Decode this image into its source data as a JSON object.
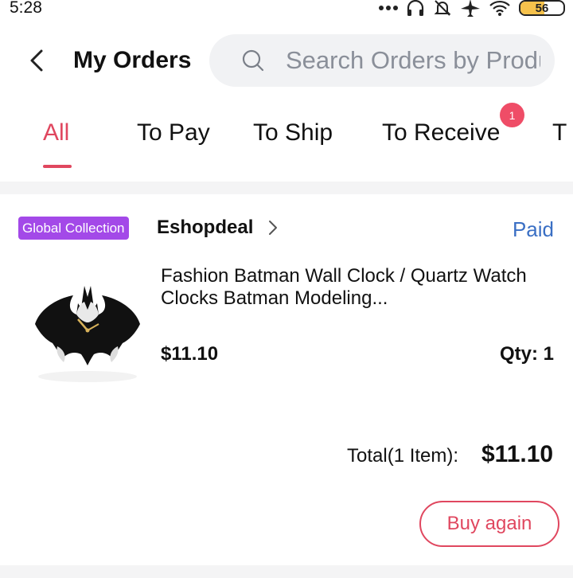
{
  "status_bar": {
    "time": "5:28",
    "battery": "56",
    "battery_level": 0.56,
    "icons": [
      "more-dots-icon",
      "headset-icon",
      "bell-off-icon",
      "airplane-icon",
      "wifi-icon",
      "battery-icon"
    ]
  },
  "header": {
    "title": "My Orders",
    "search_placeholder": "Search Orders by Product Name"
  },
  "tabs": [
    {
      "label": "All",
      "active": true
    },
    {
      "label": "To Pay"
    },
    {
      "label": "To Ship"
    },
    {
      "label": "To Receive",
      "badge": "1"
    },
    {
      "label": "T"
    }
  ],
  "order": {
    "store_tag": "Global Collection",
    "store_name": "Eshopdeal",
    "status": "Paid",
    "product_title": "Fashion Batman Wall Clock / Quartz Watch Clocks Batman Modeling...",
    "price": "$11.10",
    "qty": "Qty: 1",
    "total_label": "Total(1 Item):",
    "total_value": "$11.10",
    "buy_again": "Buy again"
  },
  "colors": {
    "accent": "#e0475f",
    "status_blue": "#3a6fc4",
    "tag_purple": "#a349e8"
  }
}
